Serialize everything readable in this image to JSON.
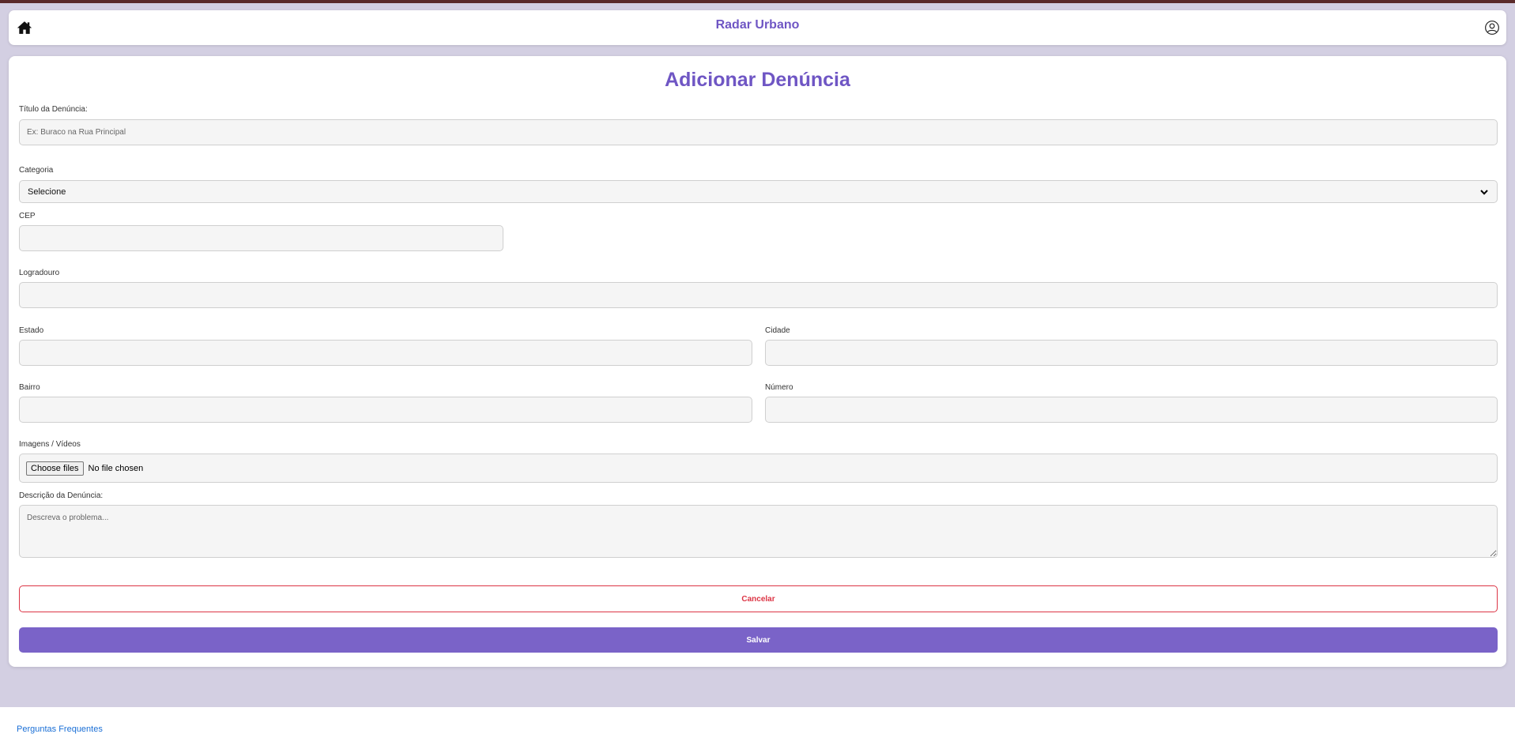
{
  "header": {
    "brand": "Radar Urbano",
    "home_icon": "home-icon",
    "user_icon": "user-circle-icon"
  },
  "form": {
    "title": "Adicionar Denúncia",
    "titulo_label": "Título da Denúncia:",
    "titulo_placeholder": "Ex: Buraco na Rua Principal",
    "titulo_value": "",
    "categoria_label": "Categoria",
    "categoria_selected": "Selecione",
    "cep_label": "CEP",
    "cep_value": "",
    "logradouro_label": "Logradouro",
    "logradouro_value": "",
    "estado_label": "Estado",
    "estado_value": "",
    "cidade_label": "Cidade",
    "cidade_value": "",
    "bairro_label": "Bairro",
    "bairro_value": "",
    "numero_label": "Número",
    "numero_value": "",
    "midia_label": "Imagens / Vídeos",
    "file_button": "Choose files",
    "file_status": "No file chosen",
    "descricao_label": "Descrição da Denúncia:",
    "descricao_placeholder": "Descreva o problema...",
    "descricao_value": "",
    "cancel_label": "Cancelar",
    "save_label": "Salvar"
  },
  "footer": {
    "faq_link": "Perguntas Frequentes"
  },
  "colors": {
    "accent": "#6f56c4",
    "save_button": "#7a63c8",
    "cancel": "#dc3545",
    "page_background": "#d3cfe2",
    "link": "#1a6fd6"
  }
}
